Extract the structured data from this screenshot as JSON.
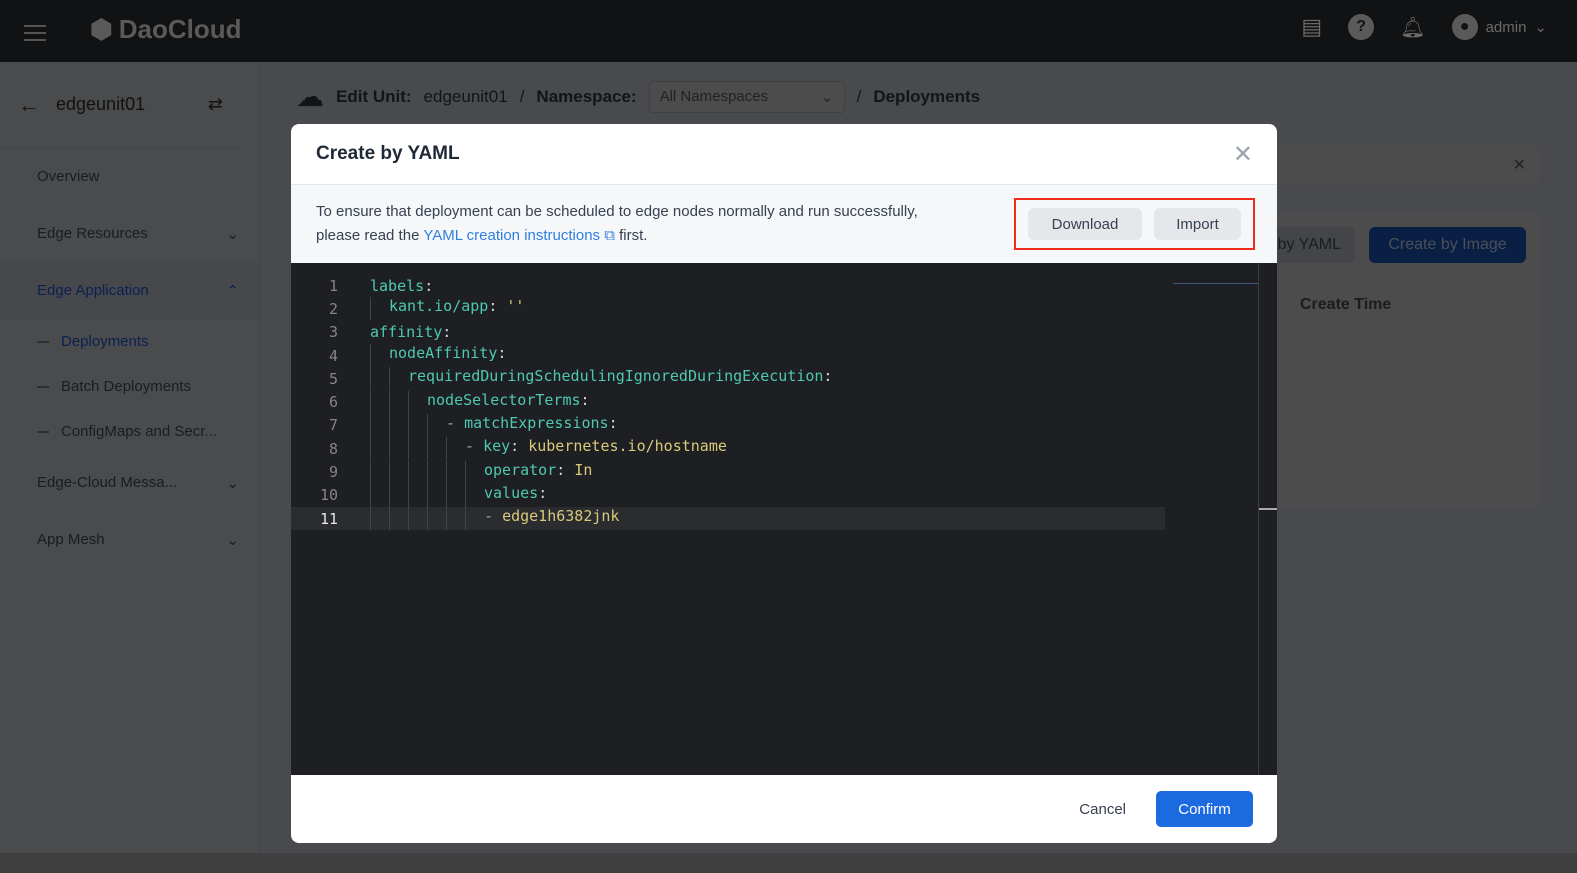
{
  "topbar": {
    "brand": "DaoCloud",
    "user": "admin",
    "icons": [
      "menu-icon",
      "message-icon",
      "help-icon",
      "bell-icon",
      "user-icon",
      "chevron-down-icon"
    ]
  },
  "sidebar": {
    "title": "edgeunit01",
    "items": [
      {
        "label": "Overview"
      },
      {
        "label": "Edge Resources"
      },
      {
        "label": "Edge Application"
      },
      {
        "label": "Edge-Cloud Messa..."
      },
      {
        "label": "App Mesh"
      }
    ],
    "subitems": [
      {
        "label": "Deployments"
      },
      {
        "label": "Batch Deployments"
      },
      {
        "label": "ConfigMaps and Secr..."
      }
    ]
  },
  "header": {
    "edit_unit_label": "Edit Unit:",
    "unit": "edgeunit01",
    "sep": "/",
    "namespace_label": "Namespace:",
    "namespace_value": "All Namespaces",
    "page": "Deployments"
  },
  "background": {
    "create_yaml": "by YAML",
    "create_image": "Create by Image",
    "col_create_time": "Create Time"
  },
  "modal": {
    "title": "Create by YAML",
    "tip_line1": "To ensure that deployment can be scheduled to edge nodes normally and run successfully,",
    "tip_pre": "please read the ",
    "tip_link": "YAML creation instructions",
    "tip_post": " first.",
    "download": "Download",
    "import": "Import",
    "cancel": "Cancel",
    "confirm": "Confirm"
  },
  "editor": {
    "lines": [
      {
        "n": "1",
        "g": 0,
        "dash": "",
        "key": "labels",
        "value": ""
      },
      {
        "n": "2",
        "g": 1,
        "dash": "",
        "key": "kant.io/app",
        "value": "''"
      },
      {
        "n": "3",
        "g": 0,
        "dash": "",
        "key": "affinity",
        "value": ""
      },
      {
        "n": "4",
        "g": 1,
        "dash": "",
        "key": "nodeAffinity",
        "value": ""
      },
      {
        "n": "5",
        "g": 2,
        "dash": "",
        "key": "requiredDuringSchedulingIgnoredDuringExecution",
        "value": ""
      },
      {
        "n": "6",
        "g": 3,
        "dash": "",
        "key": "nodeSelectorTerms",
        "value": ""
      },
      {
        "n": "7",
        "g": 4,
        "dash": "- ",
        "key": "matchExpressions",
        "value": ""
      },
      {
        "n": "8",
        "g": 5,
        "dash": "- ",
        "key": "key",
        "value": "kubernetes.io/hostname"
      },
      {
        "n": "9",
        "g": 6,
        "dash": "",
        "key": "operator",
        "value": "In"
      },
      {
        "n": "10",
        "g": 6,
        "dash": "",
        "key": "values",
        "value": ""
      },
      {
        "n": "11",
        "g": 6,
        "dash": "- ",
        "key": "",
        "value": "edge1h6382jnk"
      }
    ],
    "current_line": "11"
  },
  "colors": {
    "accent": "#1c6ae0",
    "highlight_border": "#f02a1c",
    "yaml_key": "#4ec9b0",
    "yaml_value": "#d7ca7b"
  }
}
